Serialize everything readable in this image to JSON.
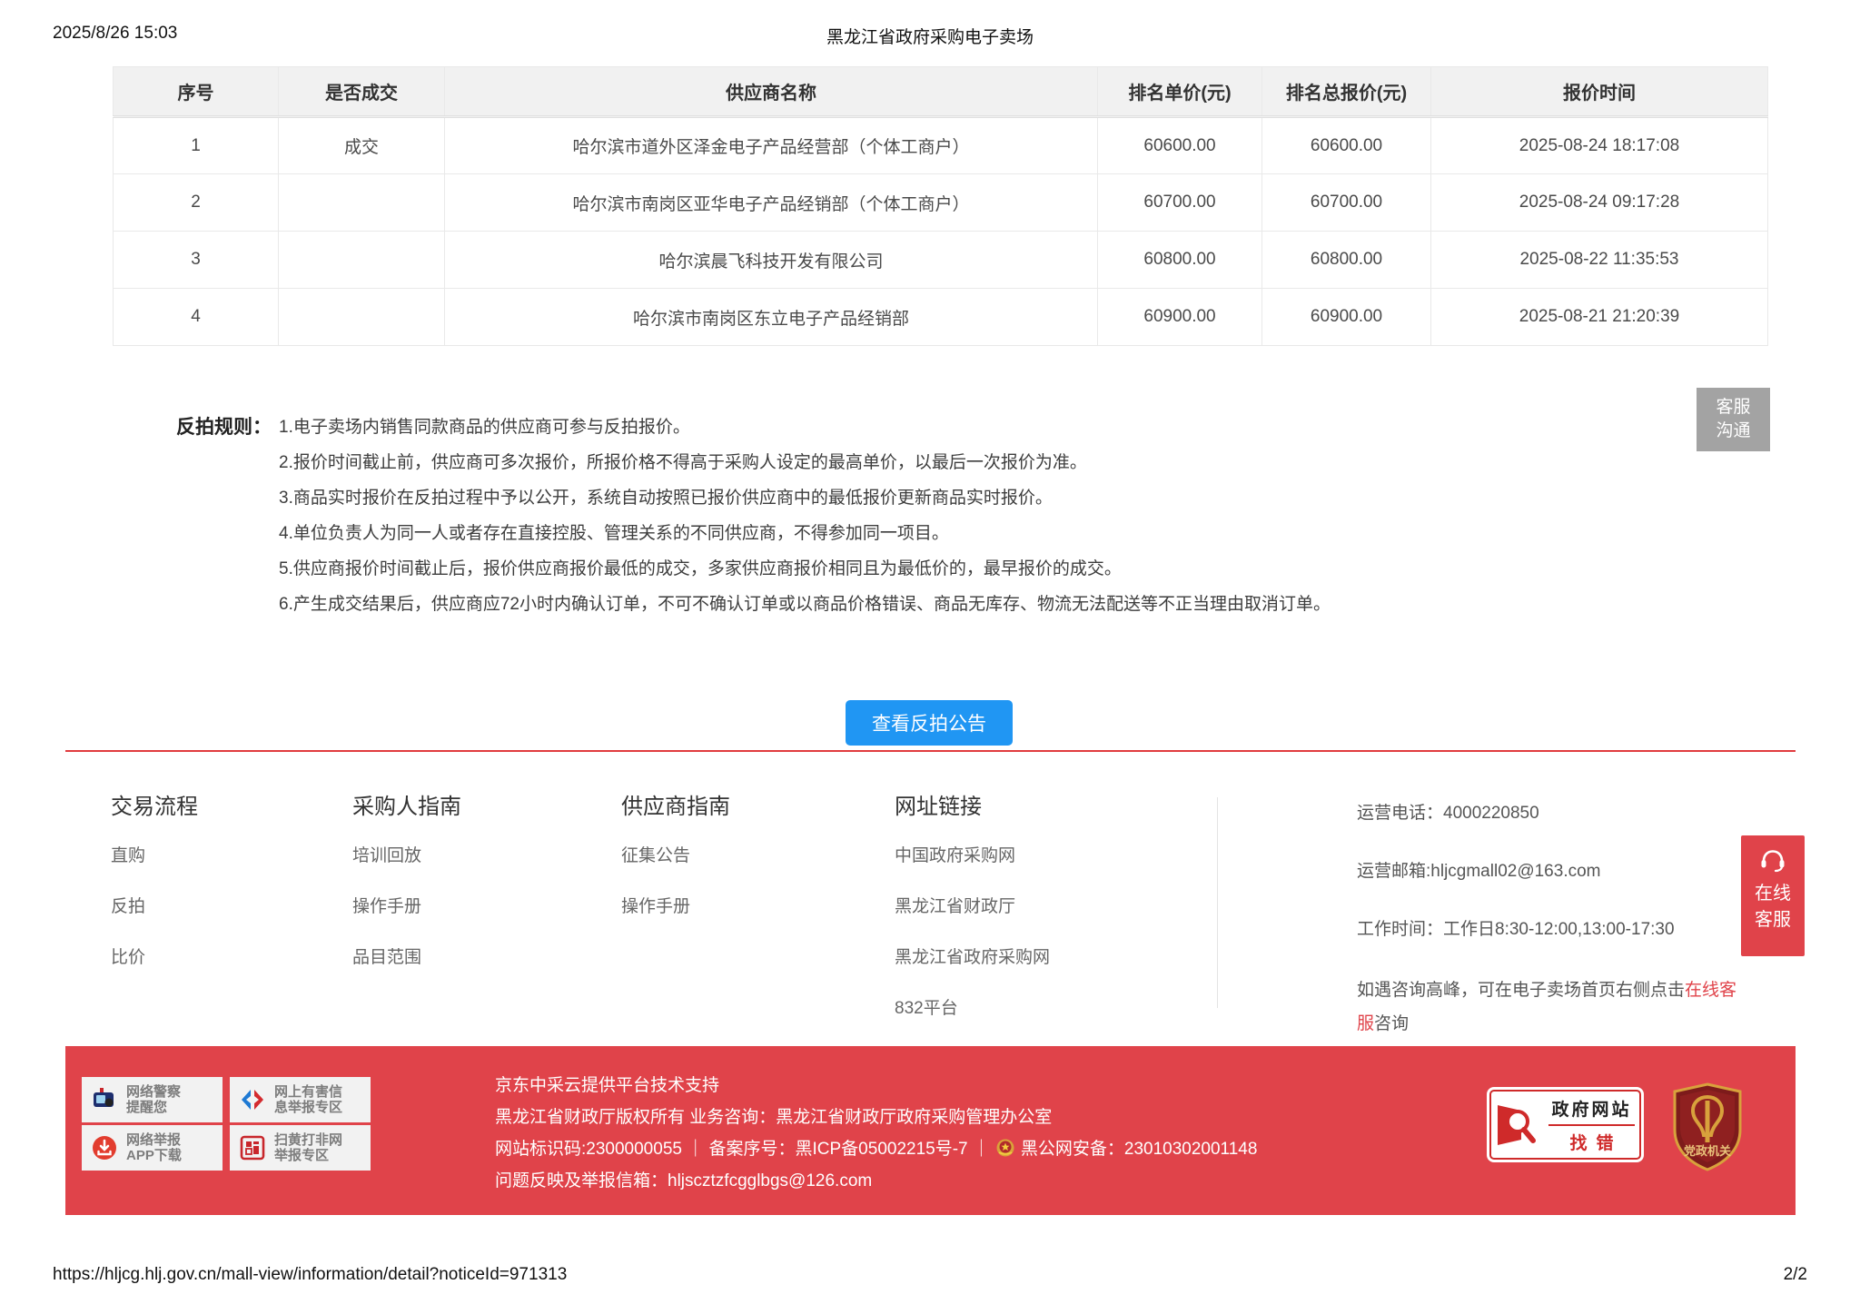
{
  "print_header": {
    "datetime": "2025/8/26 15:03",
    "title": "黑龙江省政府采购电子卖场"
  },
  "table": {
    "headers": [
      "序号",
      "是否成交",
      "供应商名称",
      "排名单价(元)",
      "排名总报价(元)",
      "报价时间"
    ],
    "rows": [
      {
        "no": "1",
        "deal": "成交",
        "supplier": "哈尔滨市道外区泽金电子产品经营部（个体工商户）",
        "unit": "60600.00",
        "total": "60600.00",
        "time": "2025-08-24 18:17:08"
      },
      {
        "no": "2",
        "deal": "",
        "supplier": "哈尔滨市南岗区亚华电子产品经销部（个体工商户）",
        "unit": "60700.00",
        "total": "60700.00",
        "time": "2025-08-24 09:17:28"
      },
      {
        "no": "3",
        "deal": "",
        "supplier": "哈尔滨晨飞科技开发有限公司",
        "unit": "60800.00",
        "total": "60800.00",
        "time": "2025-08-22 11:35:53"
      },
      {
        "no": "4",
        "deal": "",
        "supplier": "哈尔滨市南岗区东立电子产品经销部",
        "unit": "60900.00",
        "total": "60900.00",
        "time": "2025-08-21 21:20:39"
      }
    ]
  },
  "rules": {
    "label": "反拍规则：",
    "items": [
      "1.电子卖场内销售同款商品的供应商可参与反拍报价。",
      "2.报价时间截止前，供应商可多次报价，所报价格不得高于采购人设定的最高单价，以最后一次报价为准。",
      "3.商品实时报价在反拍过程中予以公开，系统自动按照已报价供应商中的最低报价更新商品实时报价。",
      "4.单位负责人为同一人或者存在直接控股、管理关系的不同供应商，不得参加同一项目。",
      "5.供应商报价时间截止后，报价供应商报价最低的成交，多家供应商报价相同且为最低价的，最早报价的成交。",
      "6.产生成交结果后，供应商应72小时内确认订单，不可不确认订单或以商品价格错误、商品无库存、物流无法配送等不正当理由取消订单。"
    ]
  },
  "cs_side_button": {
    "line1": "客服",
    "line2": "沟通"
  },
  "announce_button": "查看反拍公告",
  "online_button": {
    "line1": "在线",
    "line2": "客服"
  },
  "footer_nav": {
    "columns": [
      {
        "title": "交易流程",
        "links": [
          "直购",
          "反拍",
          "比价"
        ]
      },
      {
        "title": "采购人指南",
        "links": [
          "培训回放",
          "操作手册",
          "品目范围"
        ]
      },
      {
        "title": "供应商指南",
        "links": [
          "征集公告",
          "操作手册"
        ]
      },
      {
        "title": "网址链接",
        "links": [
          "中国政府采购网",
          "黑龙江省财政厅",
          "黑龙江省政府采购网",
          "832平台"
        ]
      }
    ],
    "contact": {
      "phone": "运营电话：4000220850",
      "email": "运营邮箱:hljcgmall02@163.com",
      "hours": "工作时间：工作日8:30-12:00,13:00-17:30",
      "note_prefix": "如遇咨询高峰，可在电子卖场首页右侧点击",
      "note_link": "在线客服",
      "note_suffix": "咨询"
    }
  },
  "red_footer": {
    "badges": [
      {
        "line1": "网络警察",
        "line2": "提醒您"
      },
      {
        "line1": "网上有害信",
        "line2": "息举报专区"
      },
      {
        "line1": "网络举报",
        "line2": "APP下载"
      },
      {
        "line1": "扫黄打非网",
        "line2": "举报专区"
      }
    ],
    "line1": "京东中采云提供平台技术支持",
    "line2": "黑龙江省财政厅版权所有 业务咨询：黑龙江省财政厅政府采购管理办公室",
    "line3_before": "网站标识码:2300000055 ｜ 备案序号：黑ICP备05002215号-7 ｜",
    "line3_after": "黑公网安备：23010302001148",
    "line4": "问题反映及举报信箱：hljscztzfcgglbgs@126.com",
    "find_error": {
      "line1": "政府网站",
      "line2": "找错"
    },
    "party_label": "党政机关"
  },
  "print_footer": {
    "url": "https://hljcg.hlj.gov.cn/mall-view/information/detail?noticeId=971313",
    "page": "2/2"
  },
  "colors": {
    "accent_blue": "#2096f3",
    "accent_red": "#e0434a",
    "table_header_bg": "#f1f1f1"
  }
}
